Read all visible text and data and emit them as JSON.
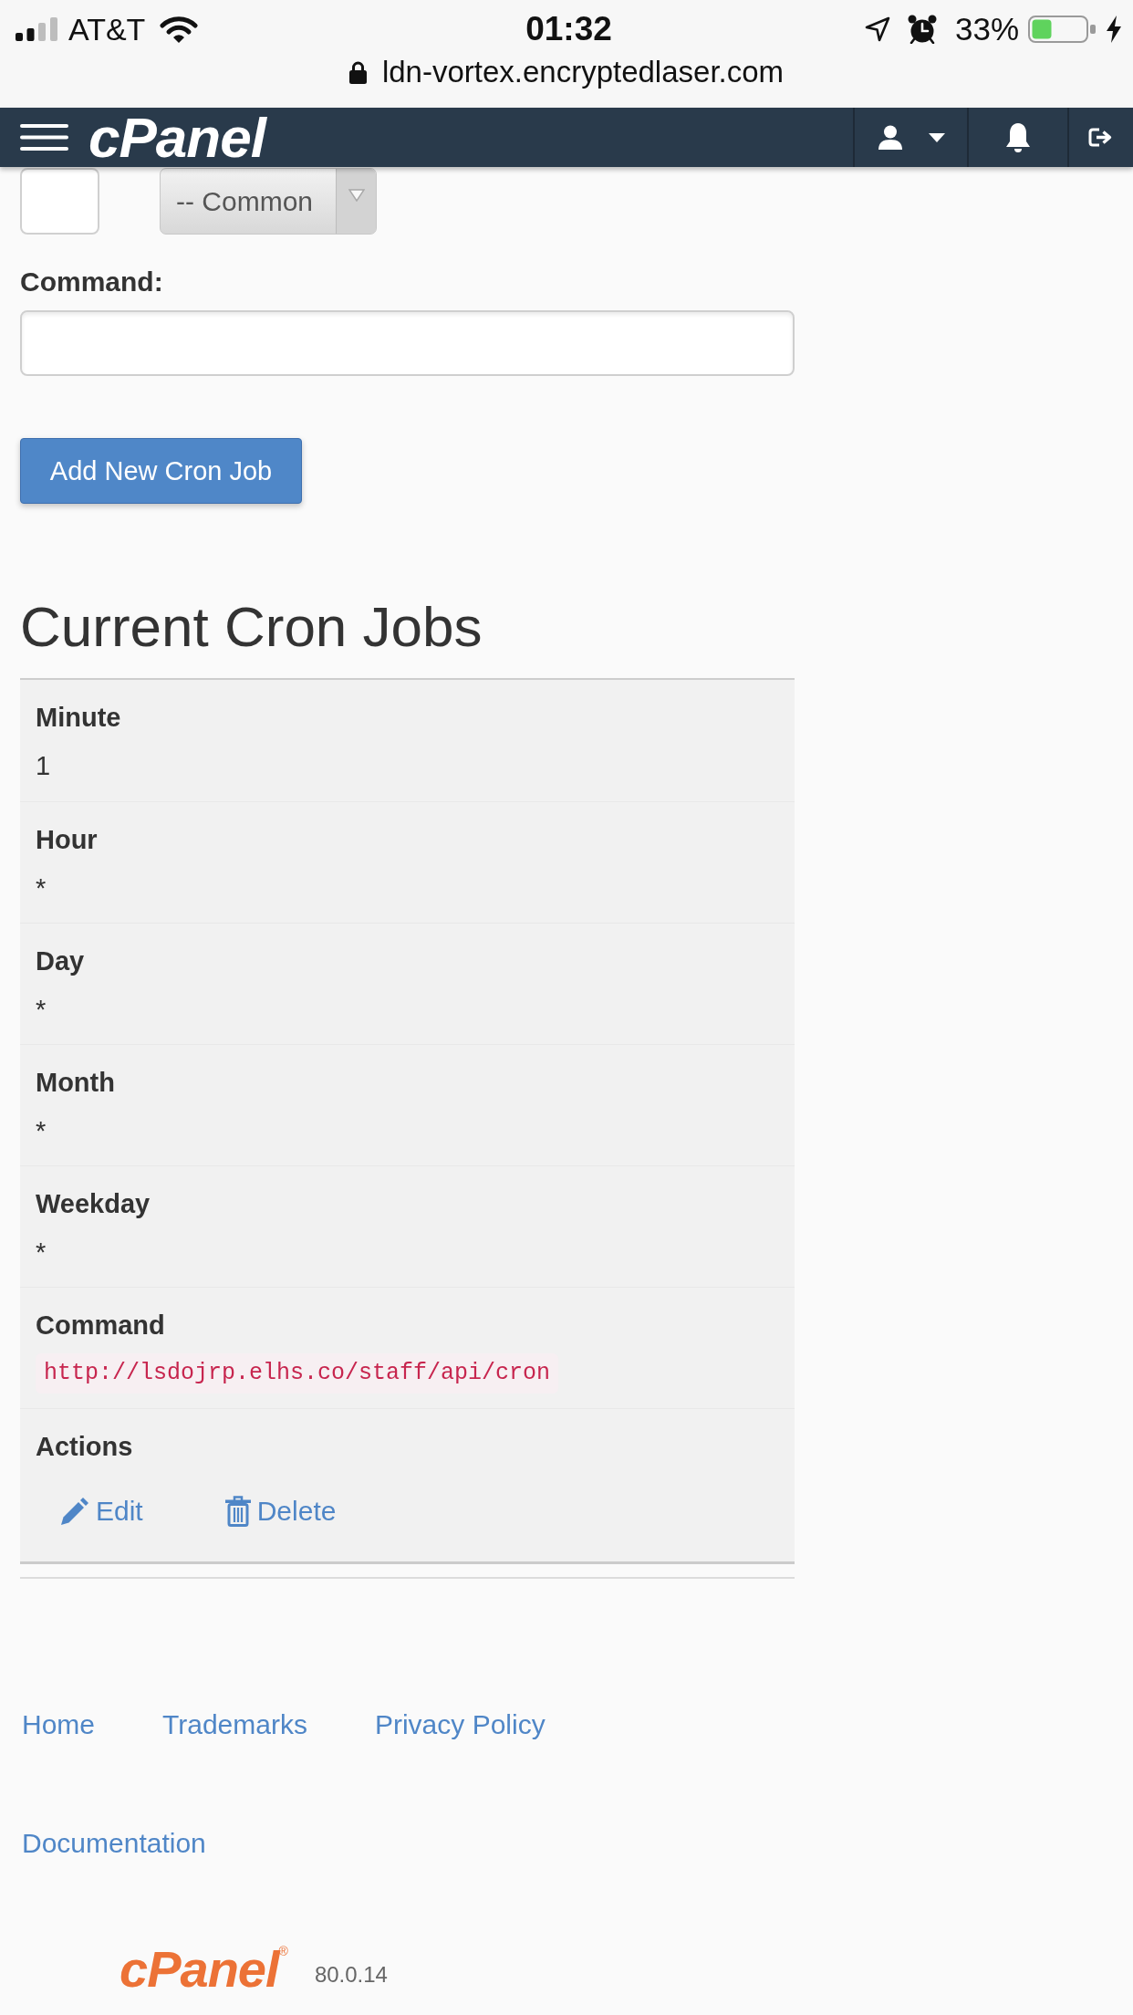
{
  "status_bar": {
    "carrier": "AT&T",
    "time": "01:32",
    "battery_percent": "33%",
    "charging": true
  },
  "address_bar": {
    "url": "ldn-vortex.encryptedlaser.com",
    "secure": true
  },
  "navbar": {
    "logo": "cPanel"
  },
  "schedule_fields": [
    {
      "kind": "input"
    },
    {
      "kind": "select",
      "value": "-- Common"
    }
  ],
  "command_field": {
    "label": "Command:"
  },
  "add_button": {
    "label": "Add New Cron Job"
  },
  "cron_jobs": {
    "title": "Current Cron Jobs",
    "rows": [
      {
        "label": "Minute",
        "kind": "text",
        "value": "1"
      },
      {
        "label": "Hour",
        "kind": "text",
        "value": "*"
      },
      {
        "label": "Day",
        "kind": "text",
        "value": "*"
      },
      {
        "label": "Month",
        "kind": "text",
        "value": "*"
      },
      {
        "label": "Weekday",
        "kind": "text",
        "value": "*"
      },
      {
        "label": "Command",
        "kind": "code",
        "value": "http://lsdojrp.elhs.co/staff/api/cron"
      },
      {
        "label": "Actions",
        "kind": "actions",
        "actions": [
          {
            "label": "Edit",
            "kind": "edit"
          },
          {
            "label": "Delete",
            "kind": "delete"
          }
        ]
      }
    ]
  },
  "footer": {
    "links": [
      "Home",
      "Trademarks",
      "Privacy Policy",
      "Documentation"
    ],
    "logo": "cPanel$^{®}$",
    "version": "80.0.14"
  }
}
